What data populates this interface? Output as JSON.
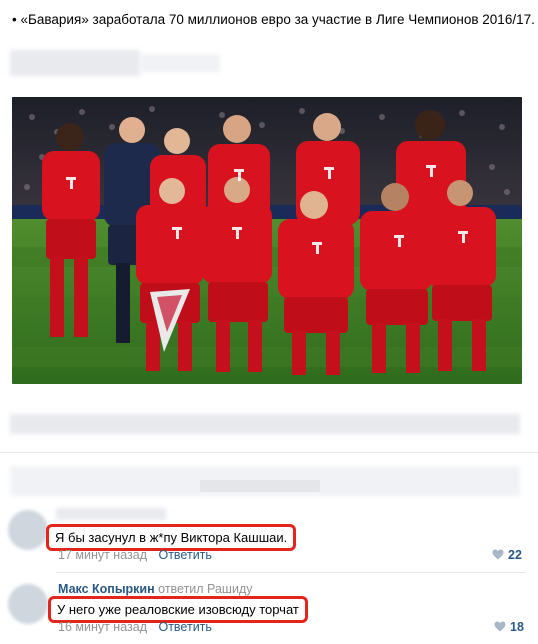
{
  "post": {
    "bullet": "•",
    "text": "«Бавария» заработала 70 миллионов евро за участие в Лиге Чемпионов 2016/17."
  },
  "comments": [
    {
      "text": "Я бы засунул в ж*пу Виктора Кашшаи.",
      "time": "17 минут назад",
      "reply_label": "Ответить",
      "likes": "22"
    },
    {
      "author": "Макс Копыркин",
      "replied_to": "ответил Рашиду",
      "text": "У него уже реаловские изовсюду торчат",
      "time": "16 минут назад",
      "reply_label": "Ответить",
      "likes": "18"
    }
  ],
  "colors": {
    "highlight": "#e2261e",
    "link": "#2a5885",
    "muted": "#939393",
    "jersey": "#d8121f"
  },
  "icons": [
    "heart-icon"
  ]
}
